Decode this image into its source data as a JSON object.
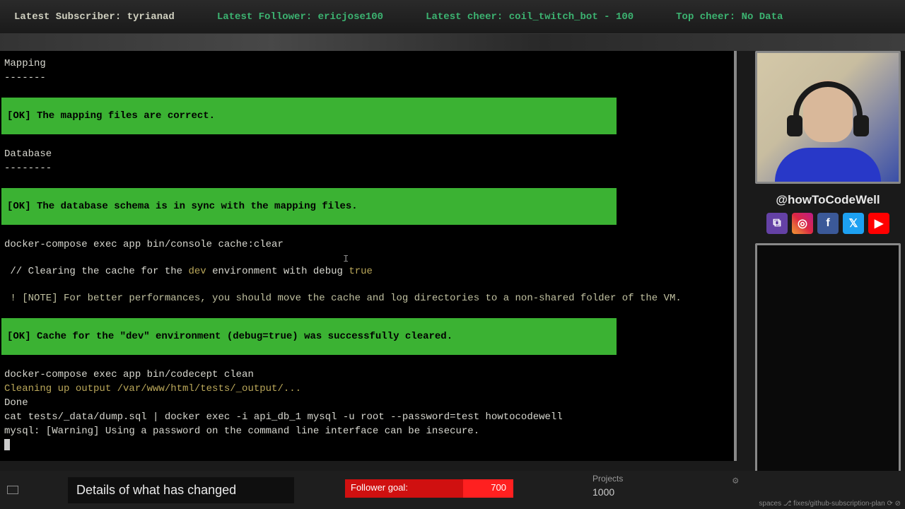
{
  "topBar": {
    "subscriber": "Latest Subscriber: tyrianad",
    "follower": "Latest Follower: ericjose100",
    "cheer": "Latest cheer: coil_twitch_bot - 100",
    "topCheer": "Top cheer: No Data"
  },
  "terminal": {
    "mapHeader": "Mapping",
    "mapUnder": "-------",
    "okMap": " [OK] The mapping files are correct.",
    "dbHeader": "Database",
    "dbUnder": "--------",
    "okDb": " [OK] The database schema is in sync with the mapping files.",
    "cmd1": "docker-compose exec app bin/console cache:clear",
    "cacheComment": " // Clearing the cache for the ",
    "cacheDev": "dev",
    "cacheComment2": " environment with debug ",
    "cacheTrue": "true",
    "note": " ! [NOTE] For better performances, you should move the cache and log directories to a non-shared folder of the VM.",
    "okCache": " [OK] Cache for the \"dev\" environment (debug=true) was successfully cleared.",
    "cmd2": "docker-compose exec app bin/codecept clean",
    "clean": "Cleaning up output /var/www/html/tests/_output/...",
    "done": "Done",
    "cmd3": "cat tests/_data/dump.sql | docker exec -i api_db_1 mysql -u root --password=test howtocodewell",
    "warn": "mysql: [Warning] Using a password on the command line interface can be insecure."
  },
  "handle": "@howToCodeWell",
  "caption": "Details of what has changed",
  "goal": {
    "label": "Follower goal:",
    "value": "700"
  },
  "projects": {
    "label": "Projects",
    "value": "1000"
  },
  "status": "spaces   ⎇ fixes/github-subscription-plan ⟳ ⊘"
}
